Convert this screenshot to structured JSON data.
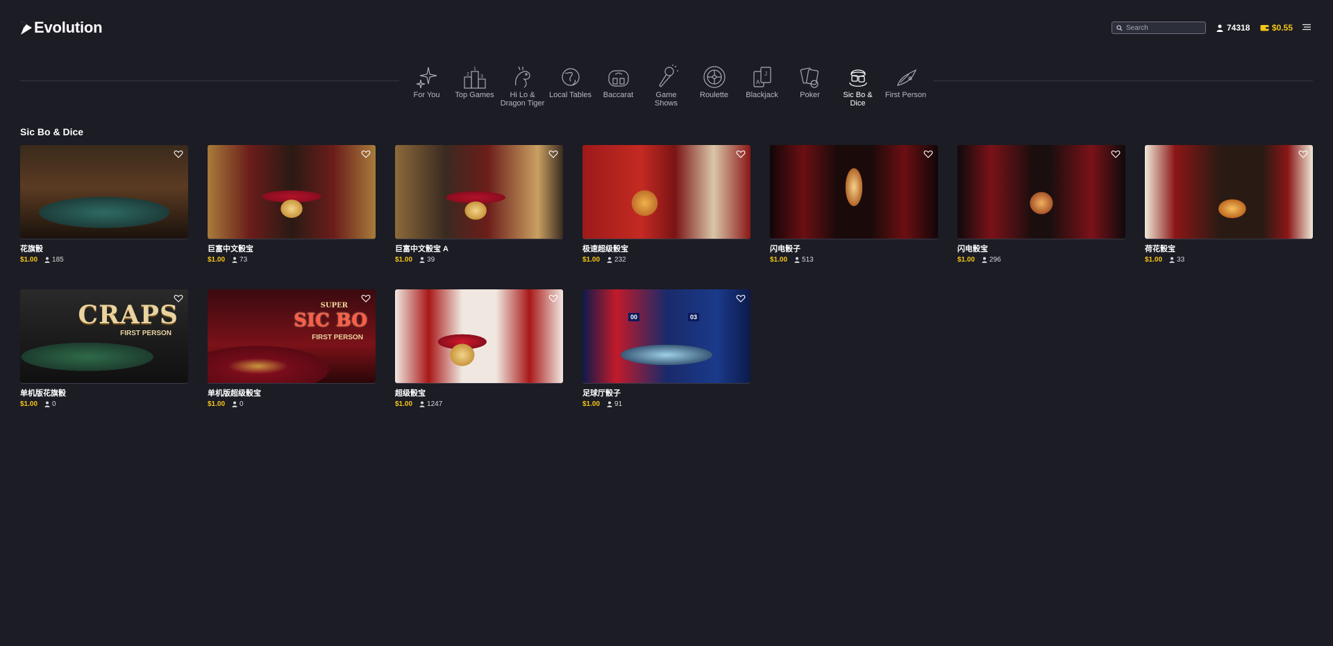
{
  "app": {
    "logo_text": "Evolution"
  },
  "header": {
    "search_placeholder": "Search",
    "players_online": "74318",
    "balance": "$0.55"
  },
  "nav": {
    "items": [
      {
        "label": "For You",
        "icon": "sparkles-icon",
        "active": false
      },
      {
        "label": "Top Games",
        "icon": "podium-icon",
        "active": false
      },
      {
        "label": "Hi Lo & Dragon Tiger",
        "icon": "dragon-icon",
        "active": false
      },
      {
        "label": "Local Tables",
        "icon": "globe-icon",
        "active": false
      },
      {
        "label": "Baccarat",
        "icon": "baccarat-icon",
        "active": false
      },
      {
        "label": "Game Shows",
        "icon": "microphone-icon",
        "active": false
      },
      {
        "label": "Roulette",
        "icon": "roulette-icon",
        "active": false
      },
      {
        "label": "Blackjack",
        "icon": "cards-icon",
        "active": false
      },
      {
        "label": "Poker",
        "icon": "poker-icon",
        "active": false
      },
      {
        "label": "Sic Bo & Dice",
        "icon": "dice-icon",
        "active": true
      },
      {
        "label": "First Person",
        "icon": "first-person-icon",
        "active": false
      }
    ]
  },
  "section": {
    "title": "Sic Bo & Dice"
  },
  "games": [
    {
      "name": "花旗骰",
      "price": "$1.00",
      "players": "185"
    },
    {
      "name": "巨富中文骰宝",
      "price": "$1.00",
      "players": "73"
    },
    {
      "name": "巨富中文骰宝 A",
      "price": "$1.00",
      "players": "39"
    },
    {
      "name": "极速超级骰宝",
      "price": "$1.00",
      "players": "232"
    },
    {
      "name": "闪电骰子",
      "price": "$1.00",
      "players": "513"
    },
    {
      "name": "闪电骰宝",
      "price": "$1.00",
      "players": "296"
    },
    {
      "name": "荷花骰宝",
      "price": "$1.00",
      "players": "33"
    },
    {
      "name": "单机版花旗骰",
      "price": "$1.00",
      "players": "0",
      "art": {
        "title": "CRAPS",
        "badge": "FIRST PERSON"
      }
    },
    {
      "name": "单机版超级骰宝",
      "price": "$1.00",
      "players": "0",
      "art": {
        "super": "SUPER",
        "title": "SIC BO",
        "badge": "FIRST PERSON"
      }
    },
    {
      "name": "超级骰宝",
      "price": "$1.00",
      "players": "1247"
    },
    {
      "name": "足球厅骰子",
      "price": "$1.00",
      "players": "91",
      "art": {
        "score_left": "00",
        "score_right": "03"
      }
    }
  ],
  "colors": {
    "background": "#1b1c24",
    "accent_gold": "#f5c518",
    "text": "#ffffff"
  }
}
